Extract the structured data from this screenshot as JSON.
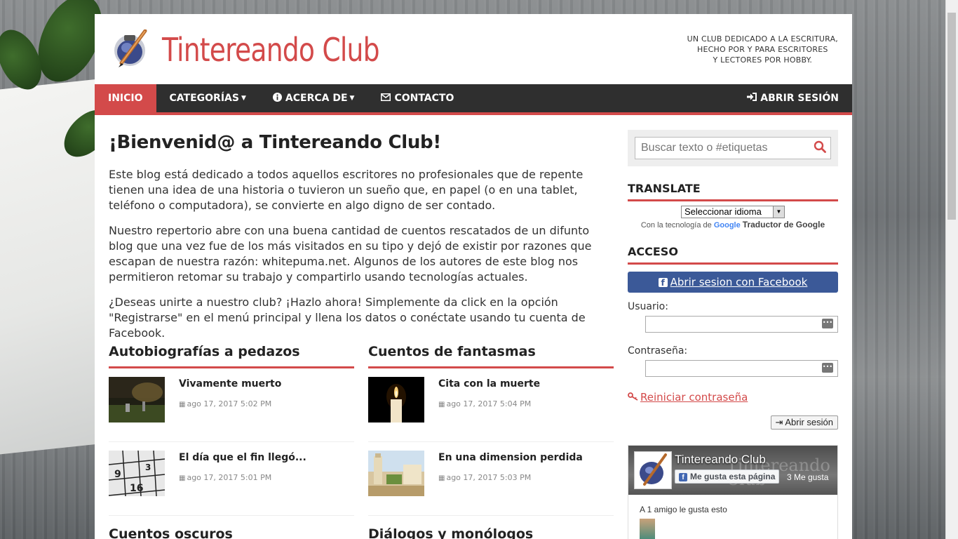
{
  "site": {
    "title": "Tintereando Club",
    "tagline": [
      "Un club dedicado a la escritura,",
      "hecho por y para escritores",
      "y lectores por hobby."
    ]
  },
  "nav": {
    "items": [
      {
        "label": "Inicio",
        "icon": "",
        "caret": false
      },
      {
        "label": "Categorías",
        "icon": "",
        "caret": true
      },
      {
        "label": "Acerca de",
        "icon": "info-circle-icon",
        "caret": true
      },
      {
        "label": "Contacto",
        "icon": "envelope-icon",
        "caret": false
      }
    ],
    "login": {
      "label": "Abrir sesión",
      "icon": "sign-in-icon"
    },
    "colors": {
      "bar": "#2f2f2f",
      "accent": "#d34a4a"
    }
  },
  "main": {
    "heading": "¡Bienvenid@ a Tintereando Club!",
    "paragraphs": [
      "Este blog está dedicado a todos aquellos escritores no profesionales que de repente tienen una idea de una historia o tuvieron un sueño que, en papel (o en una tablet, teléfono o computadora), se convierte en algo digno de ser contado.",
      "Nuestro repertorio abre con una buena cantidad de cuentos rescatados de un difunto blog que una vez fue de los más visitados en su tipo y dejó de existir por razones que escapan de nuestra razón: whitepuma.net. Algunos de los autores de este blog nos permitieron retomar su trabajo y compartirlo usando tecnologías actuales.",
      "¿Deseas unirte a nuestro club? ¡Hazlo ahora! Simplemente da click en la opción \"Registrarse\" en el menú principal y llena los datos o conéctate usando tu cuenta de Facebook."
    ],
    "categories": [
      {
        "title": "Autobiografías a pedazos",
        "posts": [
          {
            "title": "Vivamente muerto",
            "date": "ago 17, 2017 5:02 PM"
          },
          {
            "title": "El día que el fin llegó...",
            "date": "ago 17, 2017 5:01 PM"
          }
        ]
      },
      {
        "title": "Cuentos de fantasmas",
        "posts": [
          {
            "title": "Cita con la muerte",
            "date": "ago 17, 2017 5:04 PM"
          },
          {
            "title": "En una dimension perdida",
            "date": "ago 17, 2017 5:03 PM"
          }
        ]
      }
    ],
    "more_categories": [
      "Cuentos oscuros",
      "Diálogos y monólogos"
    ]
  },
  "sidebar": {
    "search_placeholder": "Buscar texto o #etiquetas",
    "translate": {
      "title": "Translate",
      "select_value": "Seleccionar idioma",
      "powered_prefix": "Con la tecnología de",
      "powered_google": "Google",
      "powered_suffix": "Traductor de Google"
    },
    "access": {
      "title": "Acceso",
      "facebook_button": "Abrir sesion con Facebook",
      "username_label": "Usuario:",
      "password_label": "Contraseña:",
      "reset_link": "Reiniciar contraseña",
      "login_button": "Abrir sesión"
    },
    "fb_page": {
      "name": "Tintereando Club",
      "like_button": "Me gusta esta página",
      "likes": "3 Me gusta",
      "friends_text": "A 1 amigo le gusta esto"
    }
  }
}
